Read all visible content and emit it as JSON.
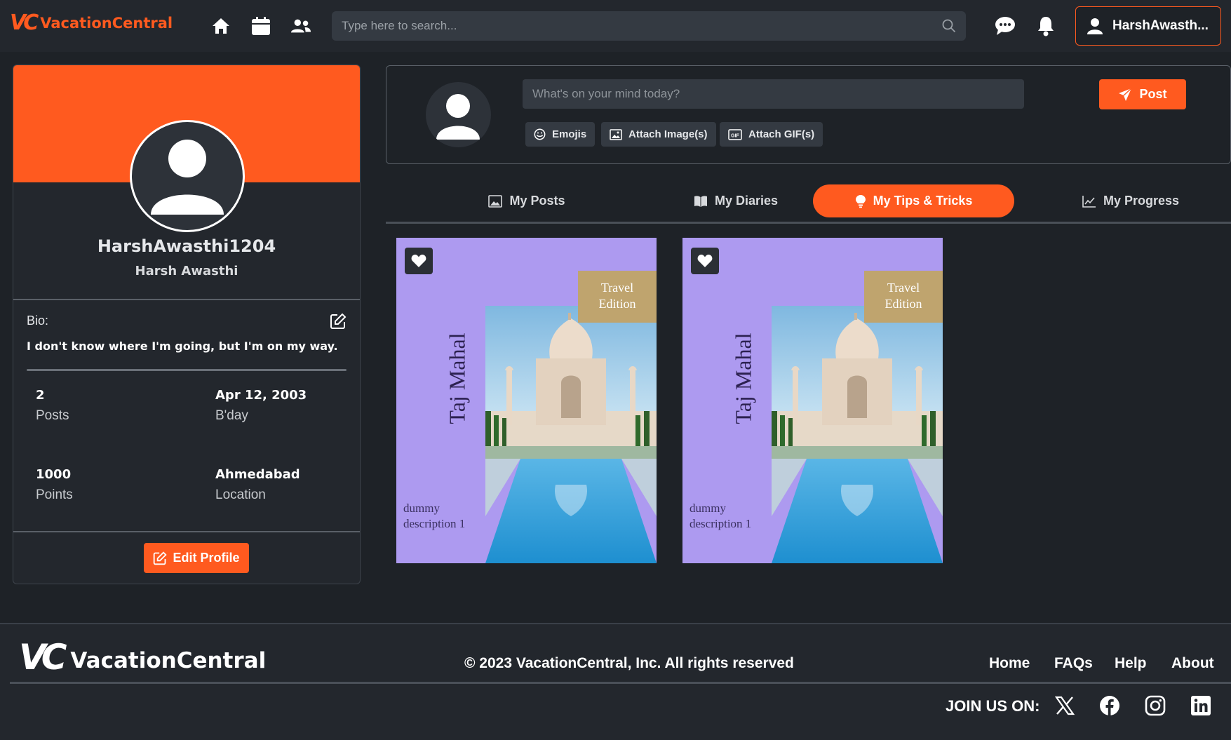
{
  "brand": {
    "logo_mark": "VC",
    "name": "VacationCentral",
    "color": "#ff5a1f"
  },
  "nav": {
    "icons": [
      "home-icon",
      "calendar-icon",
      "friends-icon",
      "chat-icon",
      "bell-icon"
    ],
    "search_placeholder": "Type here to search...",
    "user_label": "HarshAwasth..."
  },
  "profile": {
    "username": "HarshAwasthi1204",
    "full_name": "Harsh Awasthi",
    "bio_label": "Bio:",
    "bio": "I don't know where I'm going, but I'm on my way.",
    "stats": [
      {
        "value": "2",
        "label": "Posts"
      },
      {
        "value": "Apr 12, 2003",
        "label": "B'day"
      },
      {
        "value": "1000",
        "label": "Points"
      },
      {
        "value": "Ahmedabad",
        "label": "Location"
      }
    ],
    "edit_label": "Edit Profile"
  },
  "composer": {
    "placeholder": "What's on your mind today?",
    "post_label": "Post",
    "actions": [
      "Emojis",
      "Attach Image(s)",
      "Attach GIF(s)"
    ]
  },
  "tabs": [
    {
      "label": "My Posts",
      "icon": "image-icon",
      "active": false
    },
    {
      "label": "My Diaries",
      "icon": "book-icon",
      "active": false
    },
    {
      "label": "My Tips & Tricks",
      "icon": "bulb-icon",
      "active": true
    },
    {
      "label": "My Progress",
      "icon": "chart-icon",
      "active": false
    }
  ],
  "cards": [
    {
      "title": "Taj Mahal",
      "edition_line1": "Travel",
      "edition_line2": "Edition",
      "description": "dummy description 1"
    },
    {
      "title": "Taj Mahal",
      "edition_line1": "Travel",
      "edition_line2": "Edition",
      "description": "dummy description 1"
    }
  ],
  "footer": {
    "logo_mark": "VC",
    "name": "VacationCentral",
    "copyright": "© 2023 VacationCentral, Inc. All rights reserved",
    "links": [
      "Home",
      "FAQs",
      "Help",
      "About"
    ],
    "join_label": "JOIN US ON:",
    "socials": [
      "x-icon",
      "facebook-icon",
      "instagram-icon",
      "linkedin-icon"
    ]
  }
}
